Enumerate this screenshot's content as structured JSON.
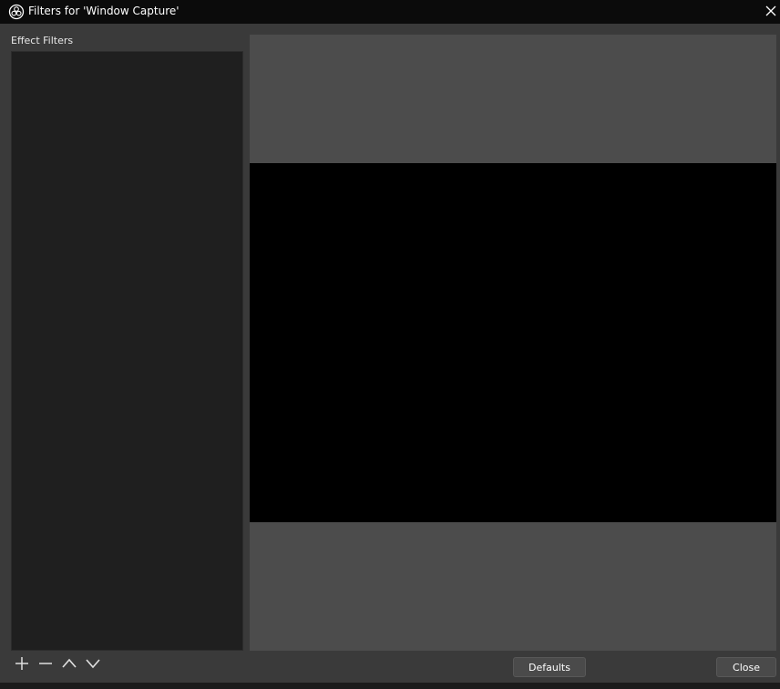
{
  "window": {
    "title": "Filters for 'Window Capture'",
    "app_icon": "obs-logo-icon",
    "close_icon": "close-icon"
  },
  "filters_panel": {
    "label": "Effect Filters",
    "items": []
  },
  "toolbar": {
    "add_icon": "plus-icon",
    "remove_icon": "minus-icon",
    "move_up_icon": "chevron-up-icon",
    "move_down_icon": "chevron-down-icon"
  },
  "buttons": {
    "defaults_label": "Defaults",
    "close_label": "Close"
  },
  "colors": {
    "titlebar_bg": "#0b0b0b",
    "window_bg": "#3a3a3a",
    "list_bg": "#1f1f1f",
    "preview_bg": "#4c4c4c",
    "video_bg": "#000000"
  }
}
